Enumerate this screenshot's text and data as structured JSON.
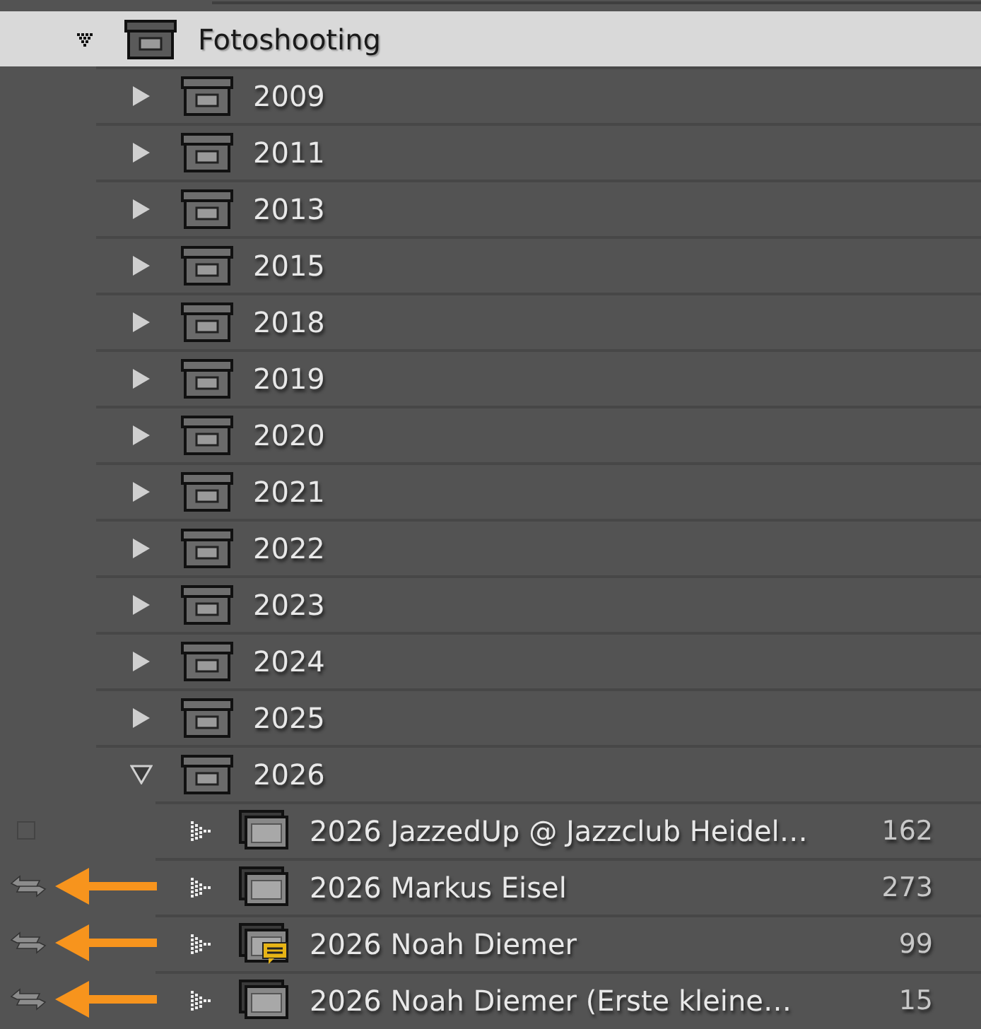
{
  "tree": {
    "label": "Fotoshooting",
    "expanded": true,
    "selected": true,
    "children": [
      {
        "label": "2009",
        "expanded": false
      },
      {
        "label": "2011",
        "expanded": false
      },
      {
        "label": "2013",
        "expanded": false
      },
      {
        "label": "2015",
        "expanded": false
      },
      {
        "label": "2018",
        "expanded": false
      },
      {
        "label": "2019",
        "expanded": false
      },
      {
        "label": "2020",
        "expanded": false
      },
      {
        "label": "2021",
        "expanded": false
      },
      {
        "label": "2022",
        "expanded": false
      },
      {
        "label": "2023",
        "expanded": false
      },
      {
        "label": "2024",
        "expanded": false
      },
      {
        "label": "2025",
        "expanded": false
      },
      {
        "label": "2026",
        "expanded": true,
        "children": [
          {
            "label": "2026 JazzedUp @ Jazzclub Heidel…",
            "count": "162",
            "synced": false,
            "comment": false,
            "annotated": false
          },
          {
            "label": "2026 Markus Eisel",
            "count": "273",
            "synced": true,
            "comment": false,
            "annotated": true
          },
          {
            "label": "2026 Noah Diemer",
            "count": "99",
            "synced": true,
            "comment": true,
            "annotated": true
          },
          {
            "label": "2026 Noah Diemer (Erste kleine…",
            "count": "15",
            "synced": true,
            "comment": false,
            "annotated": true
          }
        ]
      }
    ]
  }
}
